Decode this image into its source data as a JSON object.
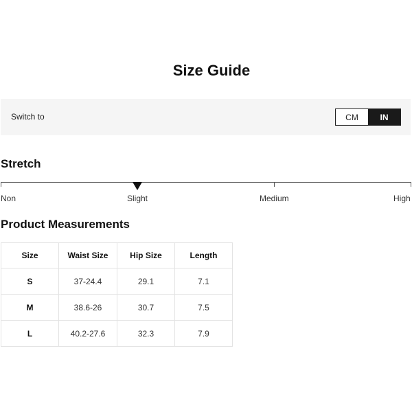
{
  "page": {
    "title": "Size Guide"
  },
  "switch": {
    "label": "Switch to",
    "options": [
      "CM",
      "IN"
    ],
    "selected": "IN"
  },
  "stretch": {
    "title": "Stretch",
    "levels": [
      "Non",
      "Slight",
      "Medium",
      "High"
    ],
    "selected": "Slight"
  },
  "measurements": {
    "title": "Product Measurements",
    "headers": [
      "Size",
      "Waist Size",
      "Hip Size",
      "Length"
    ],
    "rows": [
      [
        "S",
        "37-24.4",
        "29.1",
        "7.1"
      ],
      [
        "M",
        "38.6-26",
        "30.7",
        "7.5"
      ],
      [
        "L",
        "40.2-27.6",
        "32.3",
        "7.9"
      ]
    ]
  }
}
